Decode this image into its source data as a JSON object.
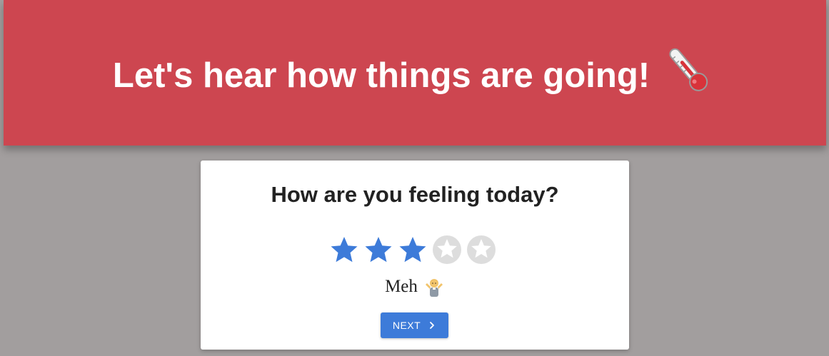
{
  "header": {
    "title": "Let's hear how things are going!",
    "icon": "thermometer-icon",
    "background_color": "#cd4650"
  },
  "card": {
    "question": "How are you feeling today?",
    "rating": {
      "value": 3,
      "max": 5,
      "filled_color": "#3d7bd9",
      "empty_color": "#dddddd"
    },
    "rating_label": "Meh",
    "rating_icon": "person-shrugging-icon",
    "next_button": {
      "label": "NEXT",
      "icon": "chevron-right-icon",
      "color": "#3d7bd9"
    }
  },
  "page": {
    "background_color": "#a29e9e"
  }
}
